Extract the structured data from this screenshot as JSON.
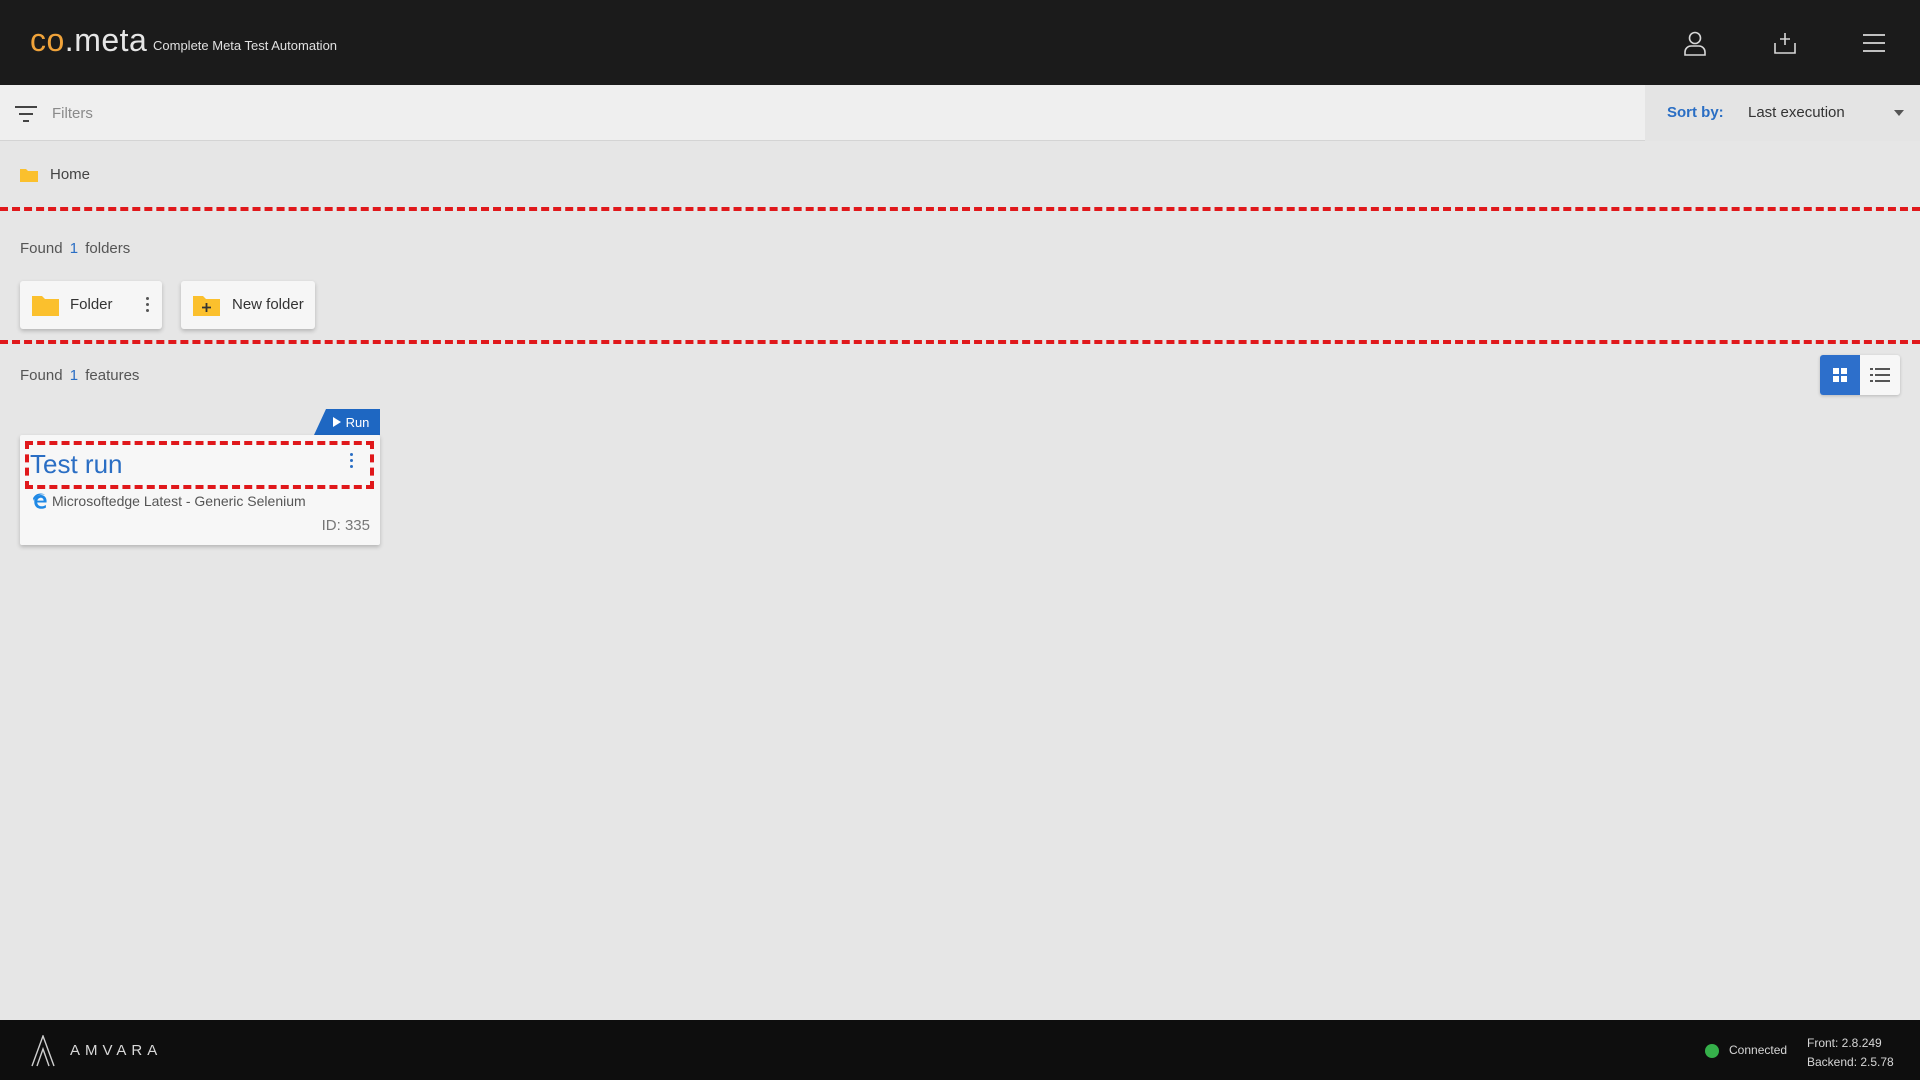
{
  "header": {
    "logo_co": "co",
    "logo_dot": ".",
    "logo_meta": "meta",
    "subtitle": "Complete Meta Test Automation",
    "icons": [
      "user-icon",
      "add-feature-icon",
      "menu-icon"
    ]
  },
  "filterbar": {
    "placeholder": "Filters",
    "sort_label": "Sort by:",
    "sort_value": "Last execution"
  },
  "breadcrumb": {
    "home": "Home"
  },
  "folders_section": {
    "found_prefix": "Found",
    "count": "1",
    "found_suffix": "folders",
    "folder_name": "Folder",
    "new_folder_label": "New folder"
  },
  "features_section": {
    "found_prefix": "Found",
    "count": "1",
    "found_suffix": "features",
    "view_mode": "grid"
  },
  "feature": {
    "run_label": "Run",
    "title": "Test run",
    "browser_icon": "edge-icon",
    "browser": "Microsoftedge Latest - Generic Selenium",
    "id_text": "ID: 335"
  },
  "footer": {
    "brand": "AMVARA",
    "status": "Connected",
    "status_color": "#35b04a",
    "front_version": "Front: 2.8.249",
    "backend_version": "Backend: 2.5.78"
  },
  "colors": {
    "accent": "#2a6ec4",
    "logo_accent": "#f0a33a",
    "highlight": "#e0181b",
    "folder": "#fbc02d"
  }
}
